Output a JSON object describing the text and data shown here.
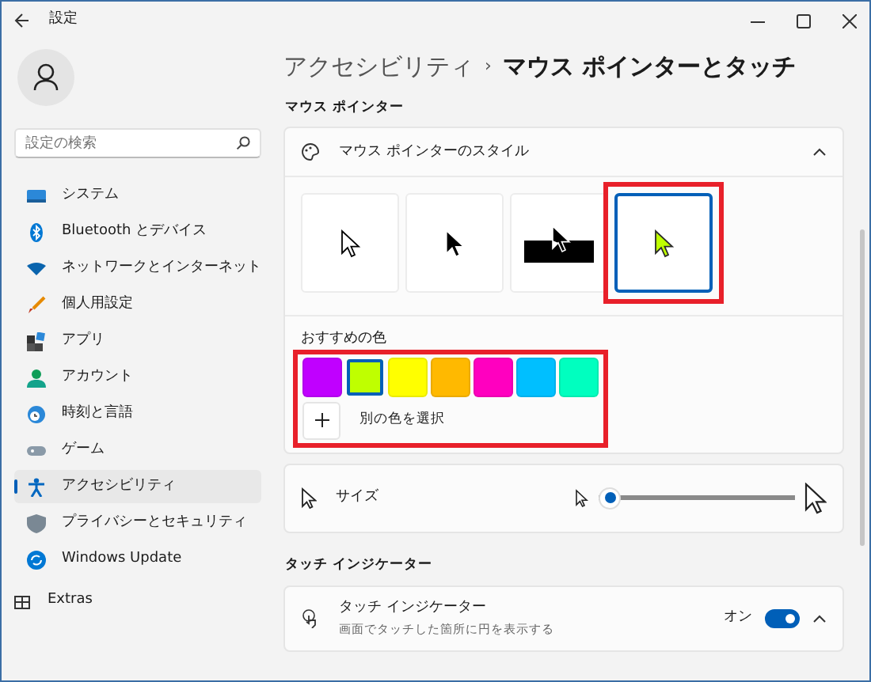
{
  "window": {
    "title": "設定"
  },
  "sidebar": {
    "search": {
      "placeholder": "設定の検索"
    },
    "items": [
      {
        "label": "システム",
        "selected": false,
        "kind": "system"
      },
      {
        "label": "Bluetooth とデバイス",
        "selected": false,
        "kind": "bluetooth"
      },
      {
        "label": "ネットワークとインターネット",
        "selected": false,
        "kind": "network"
      },
      {
        "label": "個人用設定",
        "selected": false,
        "kind": "brush"
      },
      {
        "label": "アプリ",
        "selected": false,
        "kind": "apps"
      },
      {
        "label": "アカウント",
        "selected": false,
        "kind": "account"
      },
      {
        "label": "時刻と言語",
        "selected": false,
        "kind": "time"
      },
      {
        "label": "ゲーム",
        "selected": false,
        "kind": "game"
      },
      {
        "label": "アクセシビリティ",
        "selected": true,
        "kind": "accessibility"
      },
      {
        "label": "プライバシーとセキュリティ",
        "selected": false,
        "kind": "shield"
      },
      {
        "label": "Windows Update",
        "selected": false,
        "kind": "update"
      }
    ],
    "extras": {
      "label": "Extras"
    }
  },
  "breadcrumb": {
    "parent": "アクセシビリティ",
    "separator": "›",
    "current": "マウス ポインターとタッチ"
  },
  "mouse_pointer": {
    "label": "マウス ポインター",
    "style_card": {
      "title": "マウス ポインターのスタイル",
      "expanded": true,
      "styles": [
        {
          "kind": "white",
          "selected": false
        },
        {
          "kind": "black",
          "selected": false
        },
        {
          "kind": "inverted",
          "selected": false
        },
        {
          "kind": "custom",
          "selected": true
        }
      ],
      "recommended_label": "おすすめの色",
      "colors": [
        {
          "color": "#c000ff",
          "selected": false
        },
        {
          "color": "#bfff00",
          "selected": true
        },
        {
          "color": "#ffff00",
          "selected": false
        },
        {
          "color": "#ffb900",
          "selected": false
        },
        {
          "color": "#ff00bf",
          "selected": false
        },
        {
          "color": "#00bfff",
          "selected": false
        },
        {
          "color": "#00ffbf",
          "selected": false
        }
      ],
      "custom_color_label": "別の色を選択"
    },
    "size": {
      "label": "サイズ",
      "level": 0.0
    }
  },
  "touch": {
    "label": "タッチ インジケーター",
    "card": {
      "title": "タッチ インジケーター",
      "description": "画面でタッチした箇所に円を表示する",
      "toggle_label": "オン",
      "on": true,
      "expanded": true
    }
  }
}
